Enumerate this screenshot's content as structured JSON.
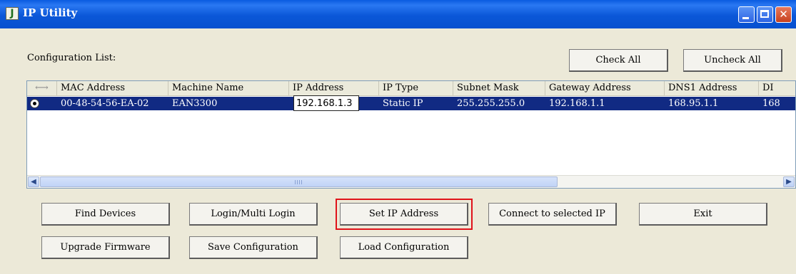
{
  "window": {
    "title": "IP Utility",
    "icon": "app-logo-icon"
  },
  "config_label": "Configuration List:",
  "top_buttons": {
    "check_all": "Check All",
    "uncheck_all": "Uncheck All"
  },
  "table": {
    "headers": [
      "MAC Address",
      "Machine Name",
      "IP Address",
      "IP Type",
      "Subnet Mask",
      "Gateway Address",
      "DNS1 Address",
      "DI"
    ],
    "row": {
      "mac": "00-48-54-56-EA-02",
      "machine": "EAN3300",
      "ip": "192.168.1.3",
      "ip_type": "Static IP",
      "subnet": "255.255.255.0",
      "gateway": "192.168.1.1",
      "dns1": "168.95.1.1",
      "dns2_partial": "168"
    }
  },
  "buttons": {
    "find_devices": "Find Devices",
    "login": "Login/Multi Login",
    "set_ip": "Set IP Address",
    "connect": "Connect to selected IP",
    "exit": "Exit",
    "upgrade": "Upgrade Firmware",
    "save_config": "Save Configuration",
    "load_config": "Load Configuration"
  },
  "colors": {
    "titlebar": "#0a5be0",
    "selection": "#112a83",
    "highlight": "#e0131a"
  }
}
